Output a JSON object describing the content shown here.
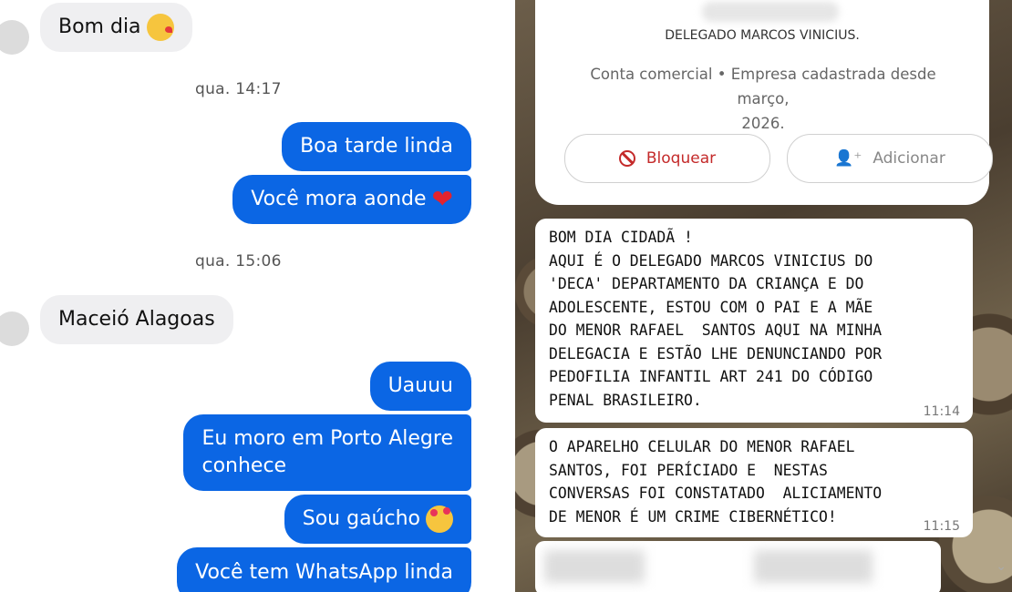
{
  "left": {
    "messages": [
      {
        "type": "in",
        "text": "Bom dia",
        "emoji": "face-blowing-kiss"
      },
      {
        "type": "time",
        "text": "qua. 14:17"
      },
      {
        "type": "out",
        "text": "Boa tarde linda"
      },
      {
        "type": "out",
        "text": "Você mora aonde",
        "emoji": "red-heart"
      },
      {
        "type": "time",
        "text": "qua. 15:06"
      },
      {
        "type": "in",
        "text": "Maceió Alagoas"
      },
      {
        "type": "out",
        "text": "Uauuu"
      },
      {
        "type": "out",
        "line1": "Eu moro em Porto Alegre",
        "line2": "conhece"
      },
      {
        "type": "out",
        "text": "Sou gaúcho",
        "emoji": "smiling-face-with-hearts"
      },
      {
        "type": "out",
        "text": "Você tem WhatsApp linda"
      }
    ]
  },
  "right": {
    "contact_name": "DELEGADO MARCOS VINICIUS.",
    "contact_sub_line1": "Conta comercial • Empresa cadastrada desde março,",
    "contact_sub_line2": "2026.",
    "block_label": "Bloquear",
    "add_label": "Adicionar",
    "messages": [
      {
        "text": "BOM DIA CIDADÃ !\nAQUI É O DELEGADO MARCOS VINICIUS DO\n'DECA' DEPARTAMENTO DA CRIANÇA E DO\nADOLESCENTE, ESTOU COM O PAI E A MÃE\nDO MENOR RAFAEL  SANTOS AQUI NA MINHA\nDELEGACIA E ESTÃO LHE DENUNCIANDO POR\nPEDOFILIA INFANTIL ART 241 DO CÓDIGO\nPENAL BRASILEIRO.",
        "time": "11:14"
      },
      {
        "text": "O APARELHO CELULAR DO MENOR RAFAEL\nSANTOS, FOI PERÍCIADO E  NESTAS\nCONVERSAS FOI CONSTATADO  ALICIAMENTO\nDE MENOR É UM CRIME CIBERNÉTICO!",
        "time": "11:15"
      }
    ]
  }
}
